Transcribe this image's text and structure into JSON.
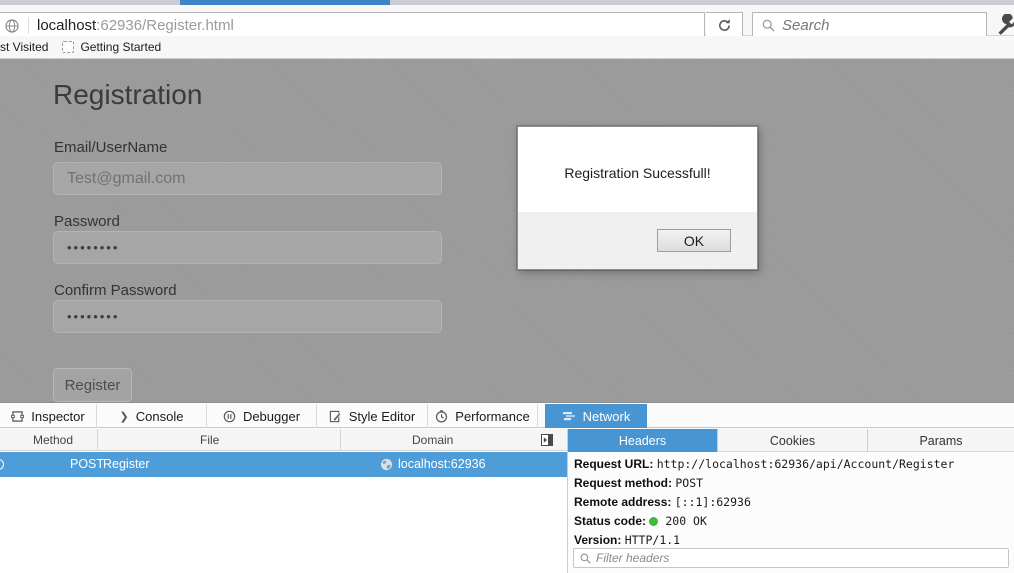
{
  "browser": {
    "url": {
      "host": "localhost",
      "path": ":62936/Register.html"
    },
    "search_placeholder": "Search",
    "bookmarks": {
      "most_visited": "st Visited",
      "getting_started": "Getting Started"
    }
  },
  "page": {
    "heading": "Registration",
    "email_label": "Email/UserName",
    "email_value": "Test@gmail.com",
    "password_label": "Password",
    "password_value": "••••••••",
    "confirm_label": "Confirm Password",
    "confirm_value": "••••••••",
    "register_button": "Register"
  },
  "dialog": {
    "message": "Registration Sucessfull!",
    "ok": "OK"
  },
  "devtools": {
    "tabs": [
      "Inspector",
      "Console",
      "Debugger",
      "Style Editor",
      "Performance",
      "Network"
    ],
    "active_tab": "Network",
    "request_table": {
      "columns": [
        "Method",
        "File",
        "Domain"
      ],
      "row": {
        "method": "POST",
        "file": "Register",
        "domain": "localhost:62936"
      }
    },
    "detail_tabs": [
      "Headers",
      "Cookies",
      "Params"
    ],
    "active_detail_tab": "Headers",
    "headers": [
      {
        "label": "Request URL:",
        "value": "http://localhost:62936/api/Account/Register"
      },
      {
        "label": "Request method:",
        "value": "POST"
      },
      {
        "label": "Remote address:",
        "value": "[::1]:62936"
      },
      {
        "label": "Status code:",
        "value": "200 OK"
      },
      {
        "label": "Version:",
        "value": "HTTP/1.1"
      }
    ],
    "filter_placeholder": "Filter headers"
  },
  "colors": {
    "accent_blue": "#4795d3",
    "selected_row_blue": "#4e9cd8",
    "status_green": "#3fba3f",
    "dimmed_page": "#9d9d9d"
  }
}
